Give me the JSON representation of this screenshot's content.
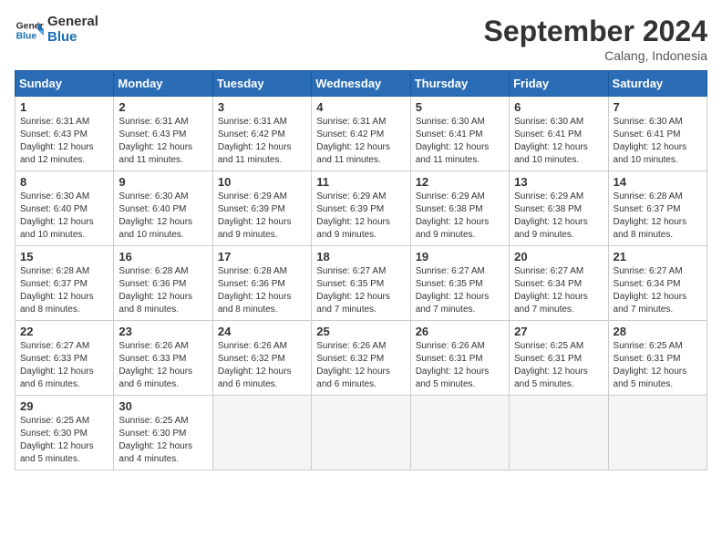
{
  "header": {
    "logo_line1": "General",
    "logo_line2": "Blue",
    "month_year": "September 2024",
    "location": "Calang, Indonesia"
  },
  "days_of_week": [
    "Sunday",
    "Monday",
    "Tuesday",
    "Wednesday",
    "Thursday",
    "Friday",
    "Saturday"
  ],
  "weeks": [
    [
      {
        "num": "1",
        "rise": "6:31 AM",
        "set": "6:43 PM",
        "daylight": "12 hours and 12 minutes."
      },
      {
        "num": "2",
        "rise": "6:31 AM",
        "set": "6:43 PM",
        "daylight": "12 hours and 11 minutes."
      },
      {
        "num": "3",
        "rise": "6:31 AM",
        "set": "6:42 PM",
        "daylight": "12 hours and 11 minutes."
      },
      {
        "num": "4",
        "rise": "6:31 AM",
        "set": "6:42 PM",
        "daylight": "12 hours and 11 minutes."
      },
      {
        "num": "5",
        "rise": "6:30 AM",
        "set": "6:41 PM",
        "daylight": "12 hours and 11 minutes."
      },
      {
        "num": "6",
        "rise": "6:30 AM",
        "set": "6:41 PM",
        "daylight": "12 hours and 10 minutes."
      },
      {
        "num": "7",
        "rise": "6:30 AM",
        "set": "6:41 PM",
        "daylight": "12 hours and 10 minutes."
      }
    ],
    [
      {
        "num": "8",
        "rise": "6:30 AM",
        "set": "6:40 PM",
        "daylight": "12 hours and 10 minutes."
      },
      {
        "num": "9",
        "rise": "6:30 AM",
        "set": "6:40 PM",
        "daylight": "12 hours and 10 minutes."
      },
      {
        "num": "10",
        "rise": "6:29 AM",
        "set": "6:39 PM",
        "daylight": "12 hours and 9 minutes."
      },
      {
        "num": "11",
        "rise": "6:29 AM",
        "set": "6:39 PM",
        "daylight": "12 hours and 9 minutes."
      },
      {
        "num": "12",
        "rise": "6:29 AM",
        "set": "6:38 PM",
        "daylight": "12 hours and 9 minutes."
      },
      {
        "num": "13",
        "rise": "6:29 AM",
        "set": "6:38 PM",
        "daylight": "12 hours and 9 minutes."
      },
      {
        "num": "14",
        "rise": "6:28 AM",
        "set": "6:37 PM",
        "daylight": "12 hours and 8 minutes."
      }
    ],
    [
      {
        "num": "15",
        "rise": "6:28 AM",
        "set": "6:37 PM",
        "daylight": "12 hours and 8 minutes."
      },
      {
        "num": "16",
        "rise": "6:28 AM",
        "set": "6:36 PM",
        "daylight": "12 hours and 8 minutes."
      },
      {
        "num": "17",
        "rise": "6:28 AM",
        "set": "6:36 PM",
        "daylight": "12 hours and 8 minutes."
      },
      {
        "num": "18",
        "rise": "6:27 AM",
        "set": "6:35 PM",
        "daylight": "12 hours and 7 minutes."
      },
      {
        "num": "19",
        "rise": "6:27 AM",
        "set": "6:35 PM",
        "daylight": "12 hours and 7 minutes."
      },
      {
        "num": "20",
        "rise": "6:27 AM",
        "set": "6:34 PM",
        "daylight": "12 hours and 7 minutes."
      },
      {
        "num": "21",
        "rise": "6:27 AM",
        "set": "6:34 PM",
        "daylight": "12 hours and 7 minutes."
      }
    ],
    [
      {
        "num": "22",
        "rise": "6:27 AM",
        "set": "6:33 PM",
        "daylight": "12 hours and 6 minutes."
      },
      {
        "num": "23",
        "rise": "6:26 AM",
        "set": "6:33 PM",
        "daylight": "12 hours and 6 minutes."
      },
      {
        "num": "24",
        "rise": "6:26 AM",
        "set": "6:32 PM",
        "daylight": "12 hours and 6 minutes."
      },
      {
        "num": "25",
        "rise": "6:26 AM",
        "set": "6:32 PM",
        "daylight": "12 hours and 6 minutes."
      },
      {
        "num": "26",
        "rise": "6:26 AM",
        "set": "6:31 PM",
        "daylight": "12 hours and 5 minutes."
      },
      {
        "num": "27",
        "rise": "6:25 AM",
        "set": "6:31 PM",
        "daylight": "12 hours and 5 minutes."
      },
      {
        "num": "28",
        "rise": "6:25 AM",
        "set": "6:31 PM",
        "daylight": "12 hours and 5 minutes."
      }
    ],
    [
      {
        "num": "29",
        "rise": "6:25 AM",
        "set": "6:30 PM",
        "daylight": "12 hours and 5 minutes."
      },
      {
        "num": "30",
        "rise": "6:25 AM",
        "set": "6:30 PM",
        "daylight": "12 hours and 4 minutes."
      },
      null,
      null,
      null,
      null,
      null
    ]
  ]
}
